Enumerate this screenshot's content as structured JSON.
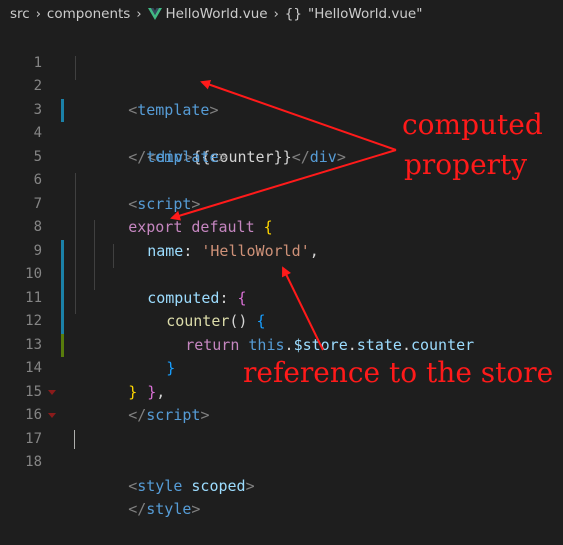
{
  "breadcrumb": {
    "items": [
      "src",
      "components",
      "HelloWorld.vue"
    ],
    "symbol_icon": "{}",
    "symbol": "\"HelloWorld.vue\""
  },
  "colors": {
    "background": "#1e1e1e",
    "annotation": "#ff1a1a",
    "modified_gutter": "#1b81a8",
    "added_gutter": "#587c0c"
  },
  "editor": {
    "lines": [
      {
        "n": "1",
        "gutter": "",
        "fold": false
      },
      {
        "n": "2",
        "gutter": "modified",
        "fold": false
      },
      {
        "n": "3",
        "gutter": "",
        "fold": false
      },
      {
        "n": "4",
        "gutter": "",
        "fold": false
      },
      {
        "n": "5",
        "gutter": "",
        "fold": false
      },
      {
        "n": "6",
        "gutter": "",
        "fold": false
      },
      {
        "n": "7",
        "gutter": "",
        "fold": false
      },
      {
        "n": "8",
        "gutter": "modified",
        "fold": false
      },
      {
        "n": "9",
        "gutter": "modified",
        "fold": false
      },
      {
        "n": "10",
        "gutter": "modified",
        "fold": false
      },
      {
        "n": "11",
        "gutter": "modified",
        "fold": false
      },
      {
        "n": "12",
        "gutter": "added",
        "fold": false
      },
      {
        "n": "13",
        "gutter": "",
        "fold": false
      },
      {
        "n": "14",
        "gutter": "",
        "fold": false
      },
      {
        "n": "15",
        "gutter": "",
        "fold": false
      },
      {
        "n": "16",
        "gutter": "",
        "fold": true
      },
      {
        "n": "17",
        "gutter": "",
        "fold": true
      },
      {
        "n": "18",
        "gutter": "",
        "fold": false
      }
    ],
    "code": {
      "l1": [
        "<",
        "template",
        ">"
      ],
      "l2": [
        "<",
        "div",
        ">",
        "{{",
        "counter",
        "}}",
        "</",
        "div",
        ">"
      ],
      "l3": [
        "</",
        "template",
        ">"
      ],
      "l5": [
        "<",
        "script",
        ">"
      ],
      "l6": [
        "export",
        " ",
        "default",
        " ",
        "{"
      ],
      "l7": [
        "name",
        ": ",
        "'HelloWorld'",
        ","
      ],
      "l8": [
        "computed",
        ": ",
        "{"
      ],
      "l9": [
        "counter",
        "() ",
        "{"
      ],
      "l10": [
        "return",
        " ",
        "this",
        ".",
        "$store",
        ".",
        "state",
        ".",
        "counter"
      ],
      "l11": [
        "}"
      ],
      "l12": [
        "}",
        ","
      ],
      "l13": [
        "}"
      ],
      "l14": [
        "</",
        "script",
        ">"
      ],
      "l16": [
        "<",
        "style",
        " ",
        "scoped",
        ">"
      ],
      "l17": [
        "</",
        "style",
        ">"
      ]
    }
  },
  "annotations": {
    "computed_line1": "computed",
    "computed_line2": "property",
    "store_ref": "reference to the store"
  }
}
